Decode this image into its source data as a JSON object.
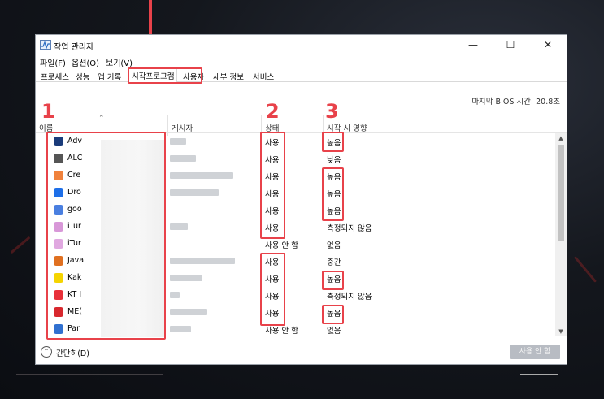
{
  "window": {
    "title": "작업 관리자",
    "controls": {
      "minimize": "—",
      "maximize": "☐",
      "close": "✕"
    }
  },
  "menu": [
    "파일(F)",
    "옵션(O)",
    "보기(V)"
  ],
  "tabs": [
    {
      "label": "프로세스",
      "active": false
    },
    {
      "label": "성능",
      "active": false
    },
    {
      "label": "앱 기록",
      "active": false
    },
    {
      "label": "시작프로그램",
      "active": true
    },
    {
      "label": "사용자",
      "active": false
    },
    {
      "label": "세부 정보",
      "active": false
    },
    {
      "label": "서비스",
      "active": false
    }
  ],
  "bios_time": "마지막 BIOS 시간:  20.8초",
  "columns": {
    "name": "이름",
    "publisher": "게시자",
    "status": "상태",
    "impact": "시작 시 영향"
  },
  "annotations": {
    "n1": "1",
    "n2": "2",
    "n3": "3"
  },
  "rows": [
    {
      "name": "Adv",
      "icon": "adv-icon",
      "icon_color": "#1a3b7a",
      "status": "사용",
      "impact": "높음"
    },
    {
      "name": "ALC",
      "icon": "alc-icon",
      "icon_color": "#555555",
      "status": "사용",
      "impact": "낮음"
    },
    {
      "name": "Cre",
      "icon": "cre-icon",
      "icon_color": "#f0823c",
      "status": "사용",
      "impact": "높음"
    },
    {
      "name": "Dro",
      "icon": "dropbox-icon",
      "icon_color": "#1e6fe8",
      "status": "사용",
      "impact": "높음"
    },
    {
      "name": "goo",
      "icon": "google-drive-icon",
      "icon_color": "#4a7fe0",
      "status": "사용",
      "impact": "높음"
    },
    {
      "name": "iTur",
      "icon": "itunes-icon",
      "icon_color": "#d898d8",
      "status": "사용",
      "impact": "측정되지 않음"
    },
    {
      "name": "iTur",
      "icon": "itunes-icon",
      "icon_color": "#e0a8e0",
      "status": "사용 안 함",
      "impact": "없음"
    },
    {
      "name": "Java",
      "icon": "java-icon",
      "icon_color": "#e07020",
      "status": "사용",
      "impact": "중간"
    },
    {
      "name": "Kak",
      "icon": "kakaotalk-icon",
      "icon_color": "#f5d400",
      "status": "사용",
      "impact": "높음"
    },
    {
      "name": "KT I",
      "icon": "kt-icon",
      "icon_color": "#e8303a",
      "status": "사용",
      "impact": "측정되지 않음"
    },
    {
      "name": "ME(",
      "icon": "me-icon",
      "icon_color": "#d8282e",
      "status": "사용",
      "impact": "높음"
    },
    {
      "name": "Par",
      "icon": "par-icon",
      "icon_color": "#3070d0",
      "status": "사용 안 함",
      "impact": "없음"
    }
  ],
  "footer": {
    "collapse_label": "간단히(D)",
    "button_label": "사용 안 함"
  },
  "accent_color": "#e8424a"
}
